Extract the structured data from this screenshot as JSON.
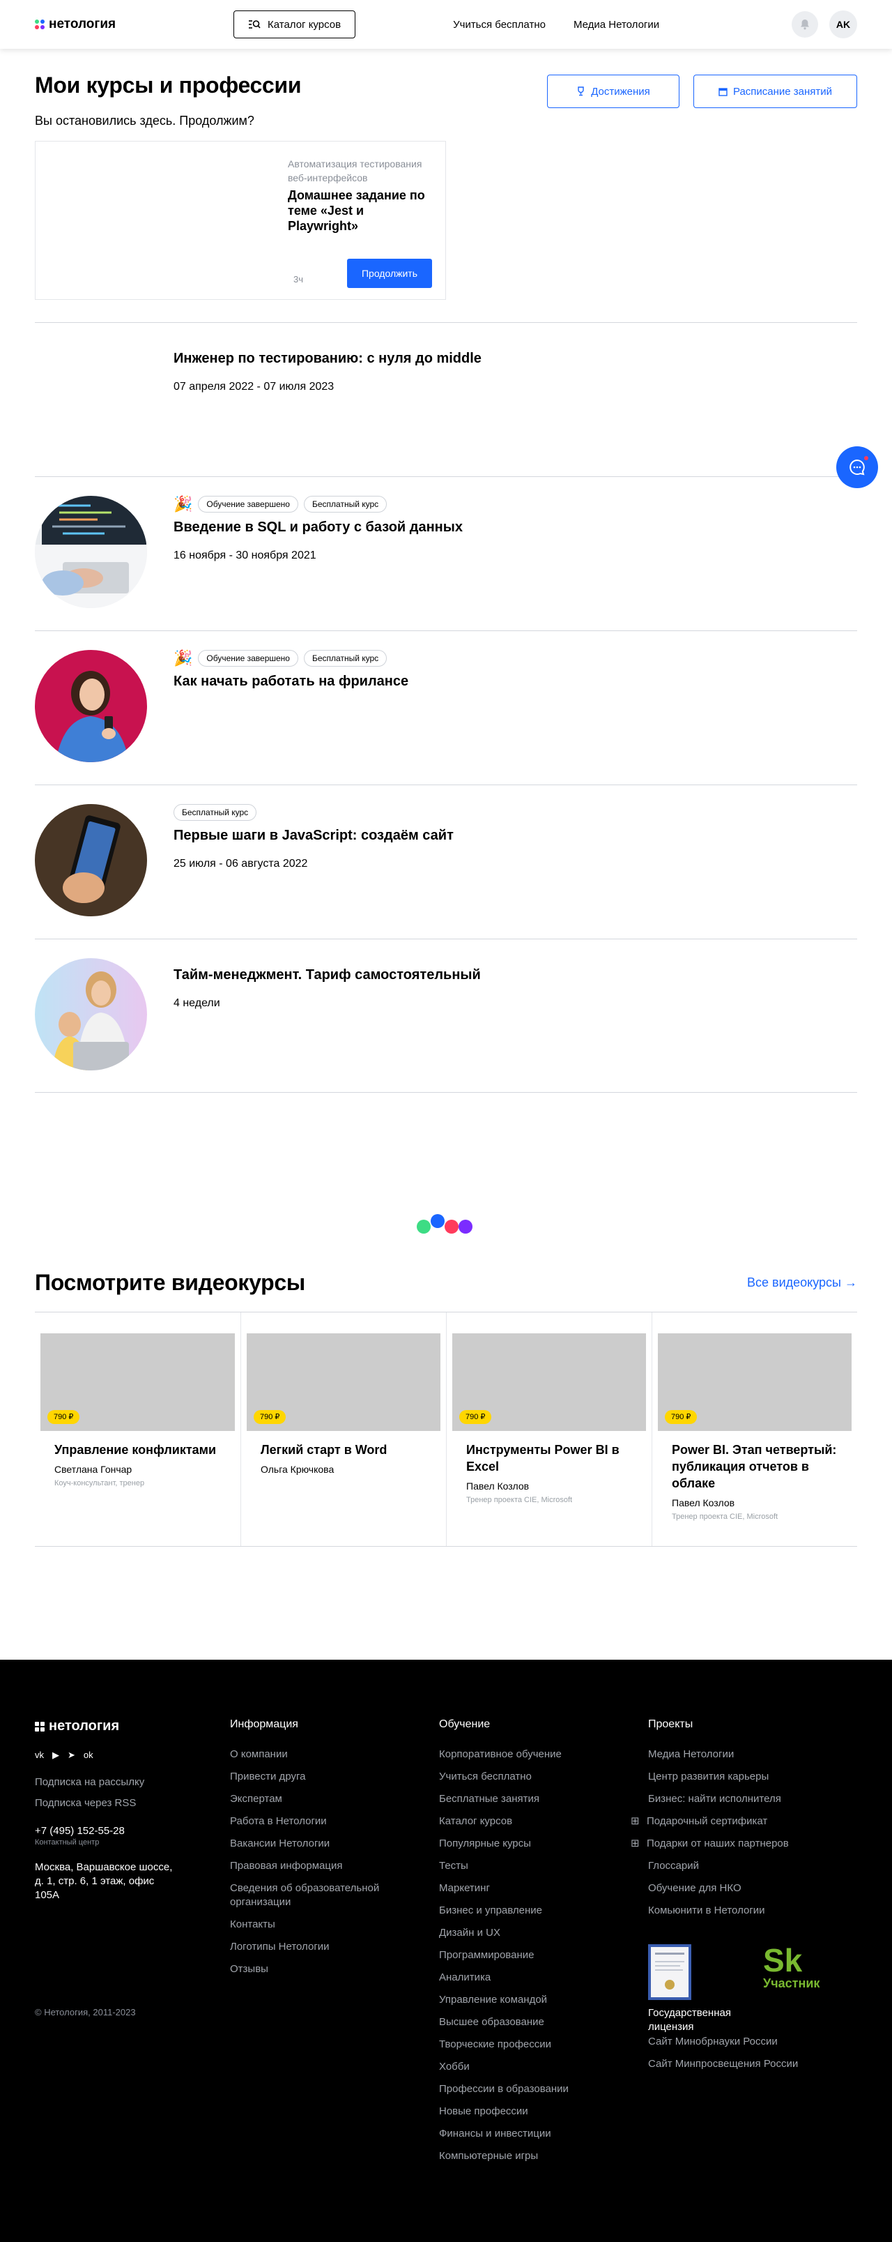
{
  "header": {
    "logo_text": "нетология",
    "catalog_label": "Каталог курсов",
    "nav": [
      "Учиться бесплатно",
      "Медиа Нетологии"
    ],
    "avatar_initials": "AK",
    "brand_colors": {
      "blue": "#1a66ff",
      "green": "#3ddc84",
      "pink": "#ff3b5c"
    }
  },
  "my_courses": {
    "title": "Мои курсы и профессии",
    "achievements_label": "Достижения",
    "schedule_label": "Расписание занятий",
    "resume_prompt": "Вы остановились здесь. Продолжим?",
    "continue_card": {
      "course": "Автоматизация тестирования веб-интерфейсов",
      "lesson": "Домашнее задание по теме «Jest и Playwright»",
      "time": "3ч",
      "button": "Продолжить"
    },
    "courses": [
      {
        "title": "Инженер по тестированию: с нуля до middle",
        "date": "07 апреля 2022 - 07 июля 2023",
        "badges": [],
        "completed": false,
        "image": "none"
      },
      {
        "title": "Введение в SQL и работу с базой данных",
        "date": "16 ноября - 30 ноября 2021",
        "badges": [
          "Обучение завершено",
          "Бесплатный курс"
        ],
        "completed": true,
        "image": "laptop-code"
      },
      {
        "title": "Как начать работать на фрилансе",
        "date": "",
        "badges": [
          "Обучение завершено",
          "Бесплатный курс"
        ],
        "completed": true,
        "image": "woman-phone-pink"
      },
      {
        "title": "Первые шаги в JavaScript: создаём сайт",
        "date": "25 июля - 06 августа 2022",
        "badges": [
          "Бесплатный курс"
        ],
        "completed": false,
        "image": "phone-dark"
      },
      {
        "title": "Тайм-менеджмент. Тариф самостоятельный",
        "date": "4 недели",
        "badges": [],
        "completed": false,
        "image": "mother-child"
      }
    ]
  },
  "videos": {
    "title": "Посмотрите видеокурсы",
    "all_label": "Все видеокурсы",
    "items": [
      {
        "price": "790 ₽",
        "name": "Управление конфликтами",
        "author": "Светлана Гончар",
        "role": "Коуч-консультант, тренер"
      },
      {
        "price": "790 ₽",
        "name": "Легкий старт в Word",
        "author": "Ольга Крючкова",
        "role": ""
      },
      {
        "price": "790 ₽",
        "name": "Инструменты Power BI в Excel",
        "author": "Павел Козлов",
        "role": "Тренер проекта CIE, Microsoft"
      },
      {
        "price": "790 ₽",
        "name": "Power BI. Этап четвертый: публикация отчетов в облаке",
        "author": "Павел Козлов",
        "role": "Тренер проекта CIE, Microsoft"
      }
    ]
  },
  "footer": {
    "logo_text": "нетология",
    "subscribe": "Подписка на рассылку",
    "rss": "Подписка через RSS",
    "phone": "+7 (495) 152-55-28",
    "phone_caption": "Контактный центр",
    "address": "Москва, Варшавское шоссе, д. 1, стр. 6, 1 этаж, офис 105А",
    "copyright": "© Нетология, 2011-2023",
    "info_title": "Информация",
    "info": [
      "О компании",
      "Привести друга",
      "Экспертам",
      "Работа в Нетологии",
      "Вакансии Нетологии",
      "Правовая информация",
      "Сведения об образовательной организации",
      "Контакты",
      "Логотипы Нетологии",
      "Отзывы"
    ],
    "edu_title": "Обучение",
    "edu": [
      "Корпоративное обучение",
      "Учиться бесплатно",
      "Бесплатные занятия",
      "Каталог курсов",
      "Популярные курсы",
      "Тесты",
      "Маркетинг",
      "Бизнес и управление",
      "Дизайн и UX",
      "Программирование",
      "Аналитика",
      "Управление командой",
      "Высшее образование",
      "Творческие профессии",
      "Хобби",
      "Профессии в образовании",
      "Новые профессии",
      "Финансы и инвестиции",
      "Компьютерные игры"
    ],
    "proj_title": "Проекты",
    "proj": [
      "Медиа Нетологии",
      "Центр развития карьеры",
      "Бизнес: найти исполнителя",
      "Подарочный сертификат",
      "Подарки от наших партнеров",
      "Глоссарий",
      "Обучение для НКО",
      "Комьюнити в Нетологии"
    ],
    "licence": "Государственная лицензия",
    "skolkovo": "Участник",
    "ministry_links": [
      "Сайт Минобрнауки России",
      "Сайт Минпросвещения России"
    ]
  }
}
